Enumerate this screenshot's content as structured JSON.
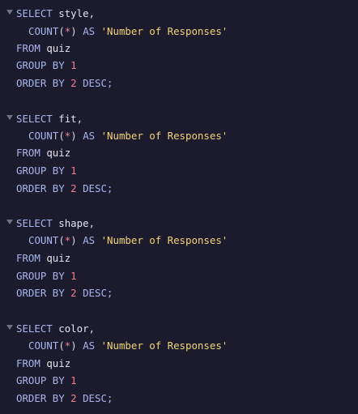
{
  "editor": {
    "queries": [
      {
        "select_kw": "SELECT",
        "column": "style",
        "comma": ",",
        "count_fn": "COUNT",
        "count_open": "(",
        "count_star": "*",
        "count_close": ")",
        "as_kw": "AS",
        "alias": "'Number of Responses'",
        "from_kw": "FROM",
        "table": "quiz",
        "group_kw": "GROUP BY",
        "group_val": "1",
        "order_kw": "ORDER BY",
        "order_val": "2",
        "order_dir": "DESC;"
      },
      {
        "select_kw": "SELECT",
        "column": "fit",
        "comma": ",",
        "count_fn": "COUNT",
        "count_open": "(",
        "count_star": "*",
        "count_close": ")",
        "as_kw": "AS",
        "alias": "'Number of Responses'",
        "from_kw": "FROM",
        "table": "quiz",
        "group_kw": "GROUP BY",
        "group_val": "1",
        "order_kw": "ORDER BY",
        "order_val": "2",
        "order_dir": "DESC;"
      },
      {
        "select_kw": "SELECT",
        "column": "shape",
        "comma": ",",
        "count_fn": "COUNT",
        "count_open": "(",
        "count_star": "*",
        "count_close": ")",
        "as_kw": "AS",
        "alias": "'Number of Responses'",
        "from_kw": "FROM",
        "table": "quiz",
        "group_kw": "GROUP BY",
        "group_val": "1",
        "order_kw": "ORDER BY",
        "order_val": "2",
        "order_dir": "DESC;"
      },
      {
        "select_kw": "SELECT",
        "column": "color",
        "comma": ",",
        "count_fn": "COUNT",
        "count_open": "(",
        "count_star": "*",
        "count_close": ")",
        "as_kw": "AS",
        "alias": "'Number of Responses'",
        "from_kw": "FROM",
        "table": "quiz",
        "group_kw": "GROUP BY",
        "group_val": "1",
        "order_kw": "ORDER BY",
        "order_val": "2",
        "order_dir": "DESC;"
      }
    ],
    "fold_icon": "chevron-down-icon",
    "colors": {
      "background": "#1b1b2d",
      "keyword": "#a9b6ec",
      "string": "#f2d477",
      "number": "#f17f8f"
    }
  }
}
